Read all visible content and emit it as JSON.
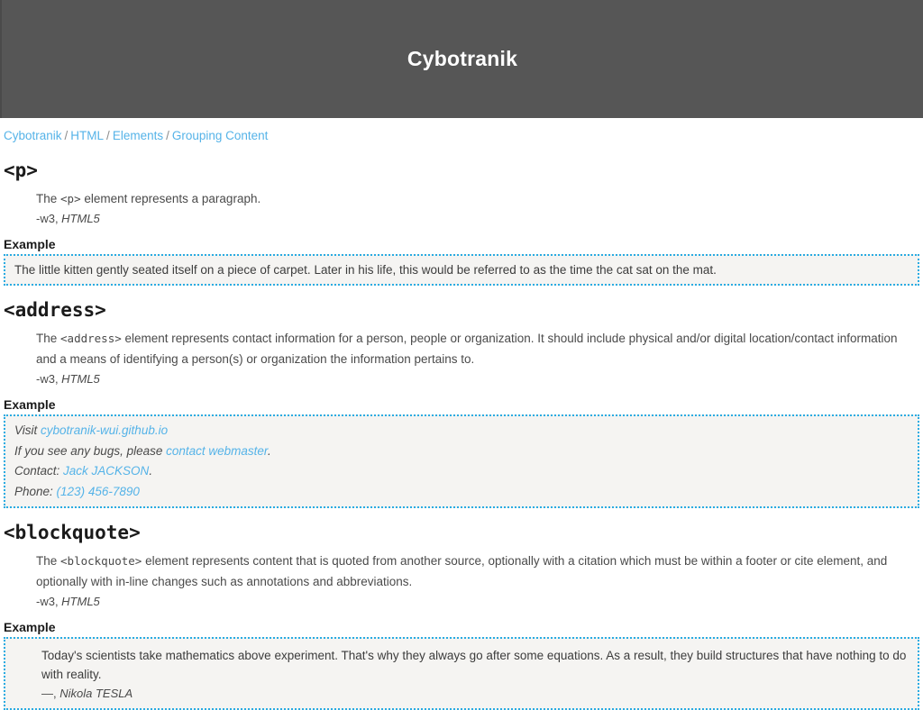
{
  "masthead": {
    "title": "Cybotranik",
    "background_color": "#565656",
    "text_color": "#ffffff"
  },
  "theme": {
    "link_color": "#55b3e8",
    "example_border_color": "#29abe2",
    "example_background_color": "#f5f4f2",
    "body_text_color": "#4a4a4a"
  },
  "breadcrumb": {
    "separator": "/",
    "items": [
      {
        "label": "Cybotranik"
      },
      {
        "label": "HTML"
      },
      {
        "label": "Elements"
      },
      {
        "label": "Grouping Content"
      }
    ]
  },
  "sections": [
    {
      "heading": "<p>",
      "description_prefix": "The ",
      "description_code": "<p>",
      "description_suffix": " element represents a paragraph.",
      "cite_source": "-w3, ",
      "cite_spec": "HTML5",
      "example_label": "Example",
      "example_paragraph": "The little kitten gently seated itself on a piece of carpet. Later in his life, this would be referred to as the time the cat sat on the mat."
    },
    {
      "heading": "<address>",
      "description_prefix": "The ",
      "description_code": "<address>",
      "description_suffix": " element represents contact information for a person, people or organization. It should include physical and/or digital location/contact information and a means of identifying a person(s) or organization the information pertains to.",
      "cite_source": "-w3, ",
      "cite_spec": "HTML5",
      "example_label": "Example",
      "address_lines": [
        {
          "lead": "Visit ",
          "link": "cybotranik-wui.github.io",
          "tail": ""
        },
        {
          "lead": "If you see any bugs, please ",
          "link": "contact webmaster",
          "tail": "."
        },
        {
          "lead": "Contact: ",
          "link": "Jack JACKSON",
          "tail": "."
        },
        {
          "lead": "Phone: ",
          "link": "(123) 456-7890",
          "tail": ""
        }
      ]
    },
    {
      "heading": "<blockquote>",
      "description_prefix": "The ",
      "description_code": "<blockquote>",
      "description_suffix": " element represents content that is quoted from another source, optionally with a citation which must be within a footer or cite element, and optionally with in-line changes such as annotations and abbreviations.",
      "cite_source": "-w3, ",
      "cite_spec": "HTML5",
      "example_label": "Example",
      "quote_text": "Today's scientists take mathematics above experiment. That's why they always go after some equations. As a result, they build structures that have nothing to do with reality.",
      "quote_footer_dash": "—, ",
      "quote_footer_cite": "Nikola TESLA"
    }
  ]
}
